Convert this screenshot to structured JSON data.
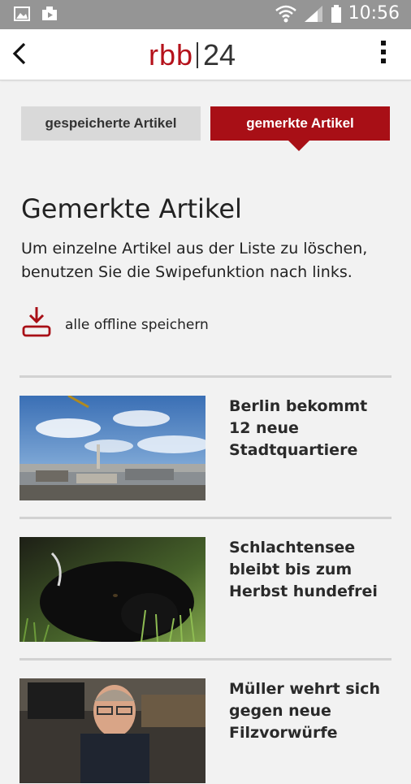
{
  "status_bar": {
    "time": "10:56",
    "icons": [
      "gallery-icon",
      "video-icon",
      "wifi-icon",
      "signal-icon",
      "battery-icon"
    ]
  },
  "app_bar": {
    "logo_left": "rbb",
    "logo_right": "24",
    "back_icon": "chevron-left-icon",
    "menu_icon": "more-vert-icon"
  },
  "tabs": [
    {
      "label": "gespeicherte Artikel",
      "active": false
    },
    {
      "label": "gemerkte Artikel",
      "active": true
    }
  ],
  "main": {
    "title": "Gemerkte Artikel",
    "intro": "Um einzelne Artikel aus der Liste zu löschen, benutzen Sie die Swipefunktion nach links.",
    "offline_label": "alle offline speichern",
    "offline_icon": "download-icon"
  },
  "articles": [
    {
      "title": "Berlin bekommt 12 neue Stadtquartiere",
      "image": "city-skyline-photo"
    },
    {
      "title": "Schlachtensee bleibt bis zum Herbst hundefrei",
      "image": "black-dog-photo"
    },
    {
      "title": "Müller wehrt sich gegen neue Filzvorwürfe",
      "image": "politician-photo"
    }
  ],
  "colors": {
    "brand_red": "#a80f16",
    "status_bar": "#959595",
    "background": "#f2f2f2"
  }
}
